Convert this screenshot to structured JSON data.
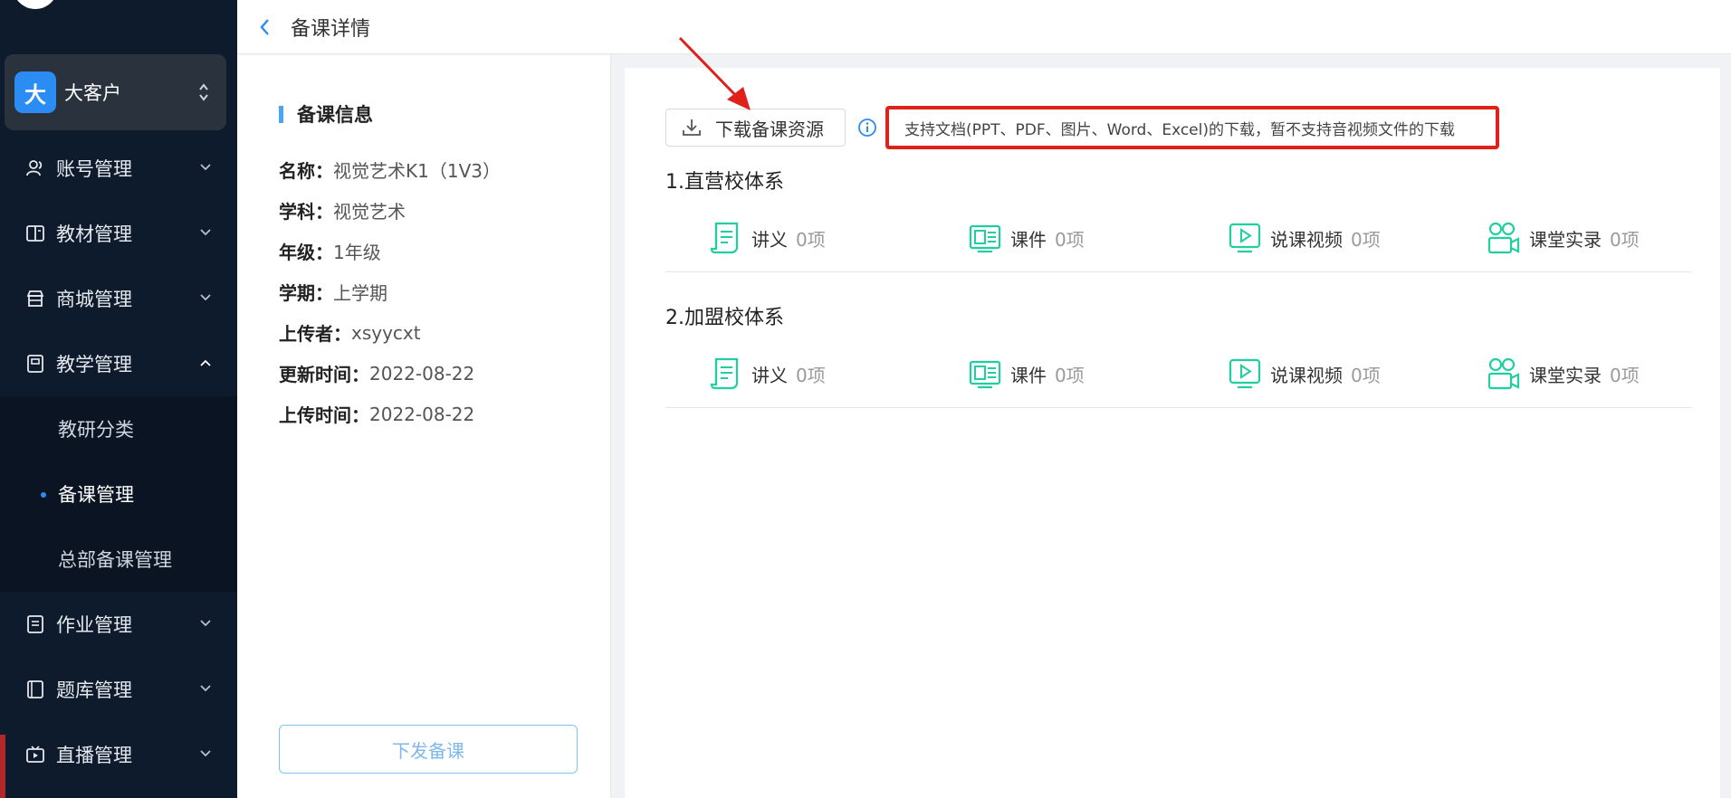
{
  "header": {
    "title": "备课详情"
  },
  "tenant": {
    "avatar_char": "大",
    "name": "大客户"
  },
  "sidebar": {
    "items": [
      {
        "label": "账号管理",
        "icon": "user-icon"
      },
      {
        "label": "教材管理",
        "icon": "book-icon"
      },
      {
        "label": "商城管理",
        "icon": "shop-icon"
      },
      {
        "label": "教学管理",
        "icon": "teaching-icon",
        "expanded": true
      },
      {
        "label": "作业管理",
        "icon": "homework-icon"
      },
      {
        "label": "题库管理",
        "icon": "question-bank-icon"
      },
      {
        "label": "直播管理",
        "icon": "live-icon"
      }
    ],
    "submenu": [
      {
        "label": "教研分类"
      },
      {
        "label": "备课管理",
        "active": true
      },
      {
        "label": "总部备课管理"
      }
    ]
  },
  "info": {
    "section_title": "备课信息",
    "rows": [
      {
        "key": "名称：",
        "value": "视觉艺术K1（1V3）"
      },
      {
        "key": "学科：",
        "value": "视觉艺术"
      },
      {
        "key": "年级：",
        "value": "1年级"
      },
      {
        "key": "学期：",
        "value": "上学期"
      },
      {
        "key": "上传者：",
        "value": "xsyycxt"
      },
      {
        "key": "更新时间：",
        "value": "2022-08-22"
      },
      {
        "key": "上传时间：",
        "value": "2022-08-22"
      }
    ],
    "dispatch_label": "下发备课"
  },
  "main": {
    "download_label": "下载备课资源",
    "tip": "支持文档(PPT、PDF、图片、Word、Excel)的下载，暂不支持音视频文件的下载",
    "groups": [
      {
        "title": "1.直营校体系",
        "resources": [
          {
            "label": "讲义",
            "count": "0项",
            "icon": "handout-icon"
          },
          {
            "label": "课件",
            "count": "0项",
            "icon": "courseware-icon"
          },
          {
            "label": "说课视频",
            "count": "0项",
            "icon": "video-icon"
          },
          {
            "label": "课堂实录",
            "count": "0项",
            "icon": "classroom-record-icon"
          }
        ]
      },
      {
        "title": "2.加盟校体系",
        "resources": [
          {
            "label": "讲义",
            "count": "0项",
            "icon": "handout-icon"
          },
          {
            "label": "课件",
            "count": "0项",
            "icon": "courseware-icon"
          },
          {
            "label": "说课视频",
            "count": "0项",
            "icon": "video-icon"
          },
          {
            "label": "课堂实录",
            "count": "0项",
            "icon": "classroom-record-icon"
          }
        ]
      }
    ]
  },
  "colors": {
    "sidebar_bg": "#0e1b2c",
    "accent": "#2b8cf3",
    "icon_green": "#1fcfa0",
    "annotation_red": "#e0201b"
  }
}
